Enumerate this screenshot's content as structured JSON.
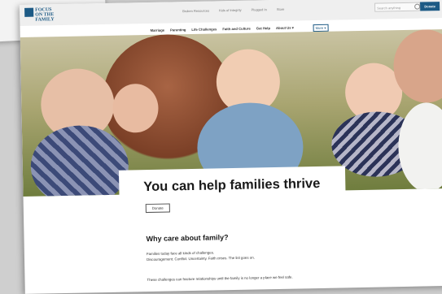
{
  "logo": {
    "text": "FOCUS ON THE FAMILY"
  },
  "utility_nav": [
    "Broken Resources",
    "Kids of Integrity",
    "Plugged In",
    "Store"
  ],
  "search": {
    "placeholder": "Search anything"
  },
  "header_donate": "Donate",
  "main_nav": [
    "Marriage",
    "Parenting",
    "Life Challenges",
    "Faith and Culture",
    "Get Help",
    "About Us ▾"
  ],
  "nav_extra": "More ▾",
  "hero": {
    "headline": "You can help families thrive"
  },
  "cta": {
    "donate_label": "Donate"
  },
  "section": {
    "heading": "Why care about family?",
    "line1": "Families today face all kinds of challenges.",
    "line2": "Discouragement. Conflict. Uncertainty. Faith crises. The list goes on.",
    "line3": "These challenges can fracture relationships until the family is no longer a place we feel safe."
  },
  "colors": {
    "brand": "#1d5a85",
    "page_bg": "#ffffff",
    "topbar": "#efefef"
  }
}
